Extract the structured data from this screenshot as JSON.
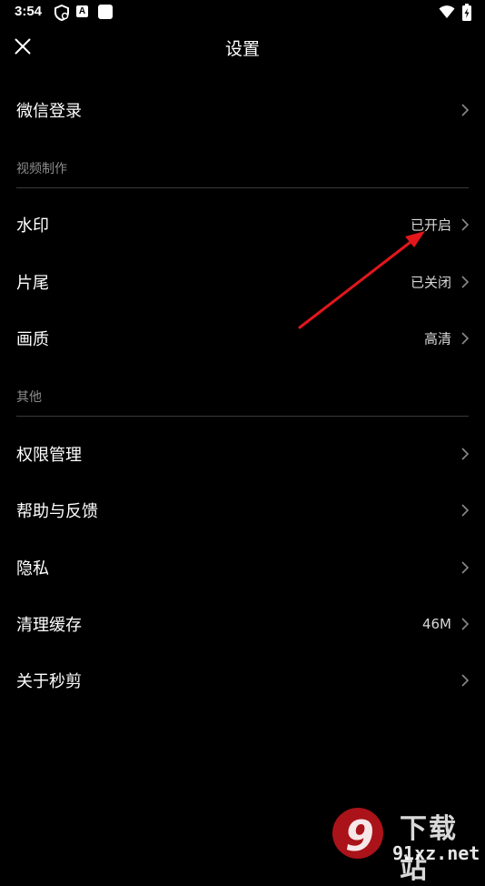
{
  "status_bar": {
    "time": "3:54",
    "a_badge": "A",
    "icons": [
      "shield-icon",
      "a-icon",
      "square-icon",
      "wifi-icon",
      "battery-icon"
    ]
  },
  "header": {
    "title": "设置",
    "close_icon": "close-icon"
  },
  "rows_top": [
    {
      "label": "微信登录",
      "value": ""
    }
  ],
  "sections": [
    {
      "header": "视频制作",
      "items": [
        {
          "label": "水印",
          "value": "已开启"
        },
        {
          "label": "片尾",
          "value": "已关闭"
        },
        {
          "label": "画质",
          "value": "高清"
        }
      ]
    },
    {
      "header": "其他",
      "items": [
        {
          "label": "权限管理",
          "value": ""
        },
        {
          "label": "帮助与反馈",
          "value": ""
        },
        {
          "label": "隐私",
          "value": ""
        },
        {
          "label": "清理缓存",
          "value": "46M"
        },
        {
          "label": "关于秒剪",
          "value": ""
        }
      ]
    }
  ],
  "watermark": {
    "logo_text": "下载站",
    "domain": "91xz.net"
  },
  "colors": {
    "background": "#000000",
    "text": "#ffffff",
    "secondary_text": "#8c8c8c",
    "annotation_arrow": "#e3161b"
  }
}
